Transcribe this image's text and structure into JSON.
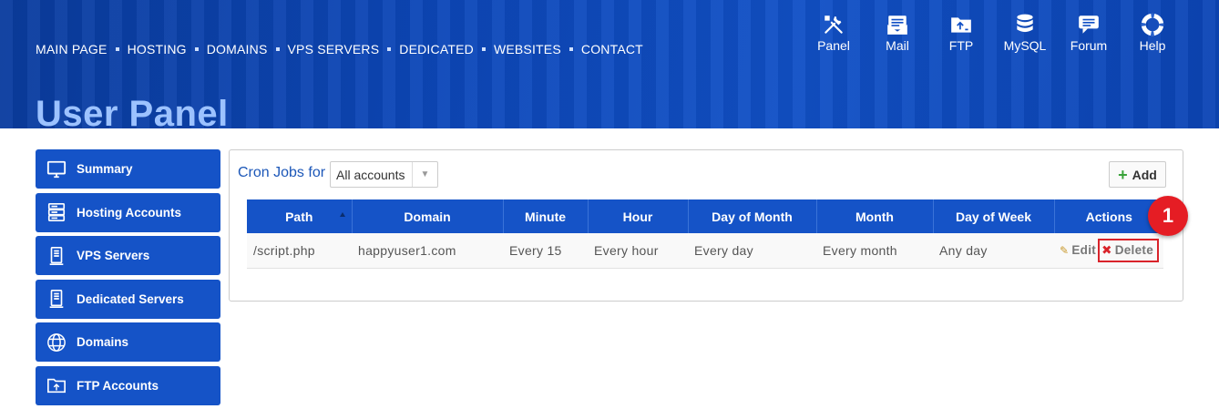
{
  "nav": {
    "items": [
      "MAIN PAGE",
      "HOSTING",
      "DOMAINS",
      "VPS SERVERS",
      "DEDICATED",
      "WEBSITES",
      "CONTACT"
    ]
  },
  "top_icons": [
    {
      "label": "Panel",
      "icon": "tools-icon"
    },
    {
      "label": "Mail",
      "icon": "mail-icon"
    },
    {
      "label": "FTP",
      "icon": "ftp-folder-icon"
    },
    {
      "label": "MySQL",
      "icon": "database-icon"
    },
    {
      "label": "Forum",
      "icon": "forum-icon"
    },
    {
      "label": "Help",
      "icon": "lifebuoy-icon"
    }
  ],
  "page_title": "User Panel",
  "sidebar": {
    "items": [
      {
        "label": "Summary",
        "icon": "monitor-icon"
      },
      {
        "label": "Hosting Accounts",
        "icon": "server-rack-icon"
      },
      {
        "label": "VPS Servers",
        "icon": "server-tower-icon"
      },
      {
        "label": "Dedicated Servers",
        "icon": "server-tower-icon"
      },
      {
        "label": "Domains",
        "icon": "www-globe-icon"
      },
      {
        "label": "FTP Accounts",
        "icon": "ftp-folder-icon"
      }
    ]
  },
  "cron": {
    "title": "Cron Jobs for",
    "account_select": "All accounts",
    "add_label": "Add"
  },
  "table": {
    "headers": [
      "Path",
      "Domain",
      "Minute",
      "Hour",
      "Day of Month",
      "Month",
      "Day of Week",
      "Actions"
    ],
    "rows": [
      {
        "path": "/script.php",
        "domain": "happyuser1.com",
        "minute": "Every 15",
        "hour": "Every hour",
        "day_of_month": "Every day",
        "month": "Every month",
        "day_of_week": "Any day",
        "edit_label": "Edit",
        "delete_label": "Delete"
      }
    ]
  },
  "annotation": {
    "step": "1"
  },
  "colors": {
    "brand_blue": "#1553c7",
    "highlight_red": "#d9232a",
    "title_blue": "#9cc2ff"
  }
}
